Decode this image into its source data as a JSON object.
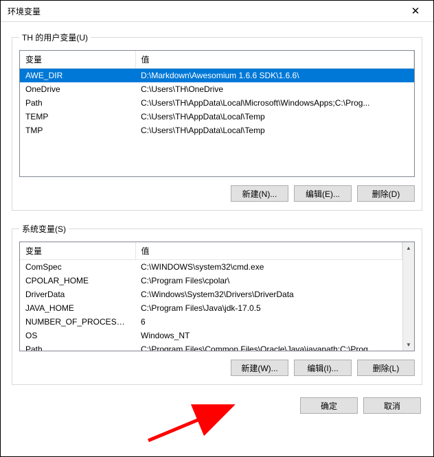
{
  "window": {
    "title": "环境变量",
    "close_glyph": "✕"
  },
  "user_group": {
    "legend": "TH 的用户变量(U)",
    "columns": {
      "variable": "变量",
      "value": "值"
    },
    "rows": [
      {
        "name": "AWE_DIR",
        "value": "D:\\Markdown\\Awesomium 1.6.6 SDK\\1.6.6\\"
      },
      {
        "name": "OneDrive",
        "value": "C:\\Users\\TH\\OneDrive"
      },
      {
        "name": "Path",
        "value": "C:\\Users\\TH\\AppData\\Local\\Microsoft\\WindowsApps;C:\\Prog..."
      },
      {
        "name": "TEMP",
        "value": "C:\\Users\\TH\\AppData\\Local\\Temp"
      },
      {
        "name": "TMP",
        "value": "C:\\Users\\TH\\AppData\\Local\\Temp"
      }
    ],
    "selected_index": 0,
    "buttons": {
      "new": "新建(N)...",
      "edit": "编辑(E)...",
      "delete": "删除(D)"
    }
  },
  "system_group": {
    "legend": "系统变量(S)",
    "columns": {
      "variable": "变量",
      "value": "值"
    },
    "rows": [
      {
        "name": "ComSpec",
        "value": "C:\\WINDOWS\\system32\\cmd.exe"
      },
      {
        "name": "CPOLAR_HOME",
        "value": "C:\\Program Files\\cpolar\\"
      },
      {
        "name": "DriverData",
        "value": "C:\\Windows\\System32\\Drivers\\DriverData"
      },
      {
        "name": "JAVA_HOME",
        "value": "C:\\Program Files\\Java\\jdk-17.0.5"
      },
      {
        "name": "NUMBER_OF_PROCESSORS",
        "value": "6"
      },
      {
        "name": "OS",
        "value": "Windows_NT"
      },
      {
        "name": "Path",
        "value": "C:\\Program Files\\Common Files\\Oracle\\Java\\javapath;C:\\Prog..."
      }
    ],
    "buttons": {
      "new": "新建(W)...",
      "edit": "编辑(I)...",
      "delete": "删除(L)"
    }
  },
  "footer": {
    "ok": "确定",
    "cancel": "取消"
  },
  "annotation": {
    "arrow_color": "#ff0000"
  }
}
